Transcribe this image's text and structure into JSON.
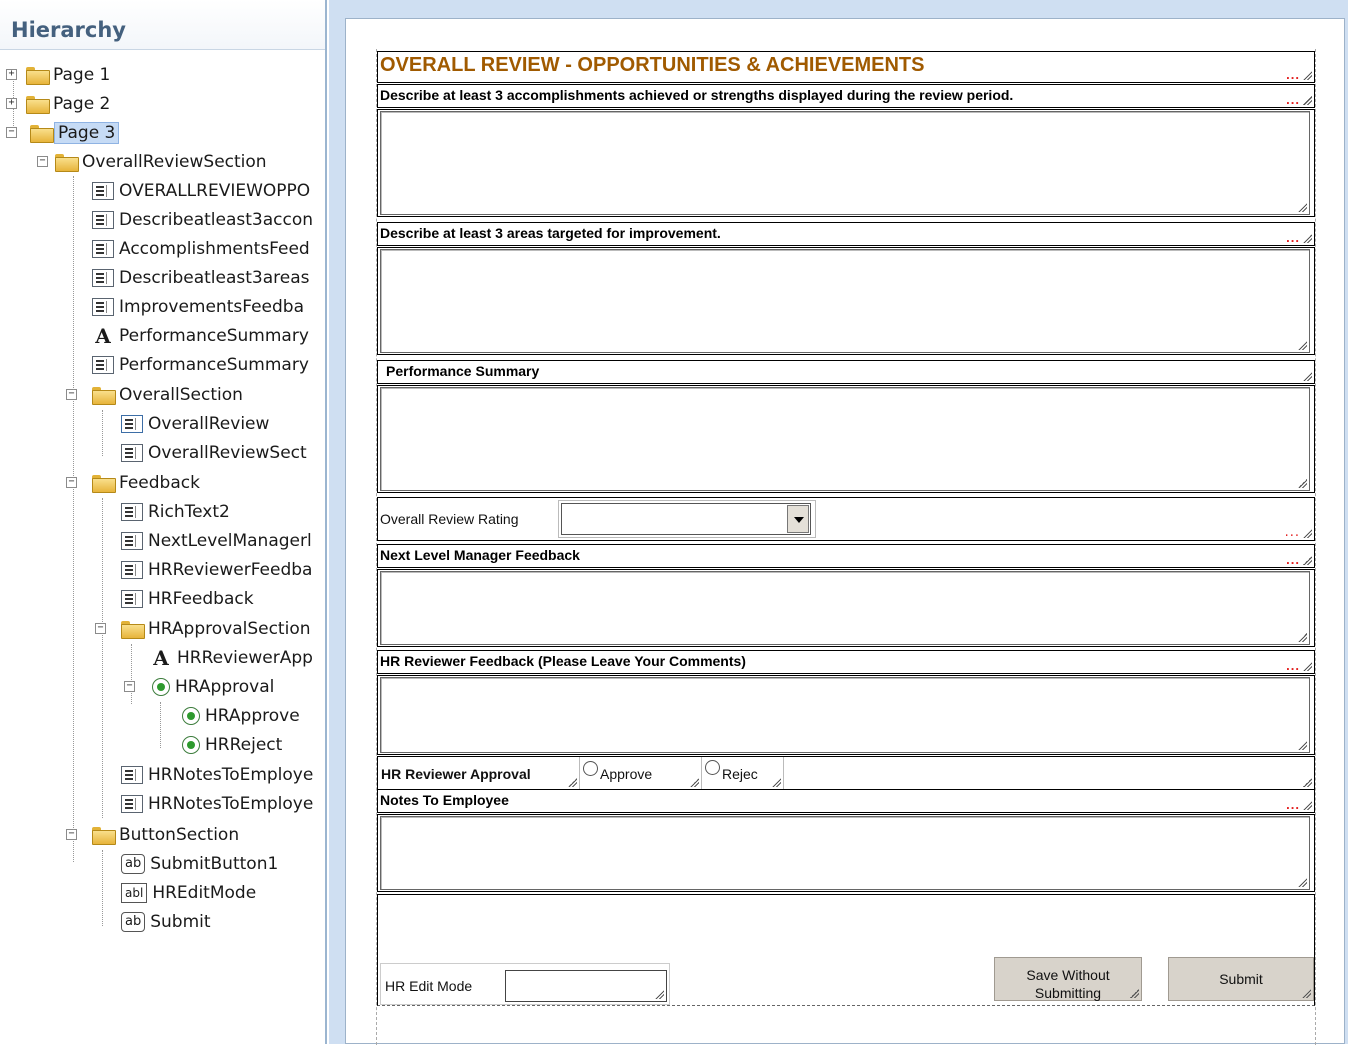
{
  "hierarchy": {
    "title": "Hierarchy",
    "nodes": [
      {
        "label": "Page 1",
        "icon": "folder"
      },
      {
        "label": "Page 2",
        "icon": "folder"
      },
      {
        "label": "Page 3",
        "icon": "folder"
      },
      {
        "label": "OverallReviewSection",
        "icon": "folder"
      },
      {
        "label": "OVERALLREVIEWOPPO",
        "icon": "field"
      },
      {
        "label": "Describeatleast3accon",
        "icon": "field"
      },
      {
        "label": "AccomplishmentsFeed",
        "icon": "field"
      },
      {
        "label": "Describeatleast3areas",
        "icon": "field"
      },
      {
        "label": "ImprovementsFeedba",
        "icon": "field"
      },
      {
        "label": "PerformanceSummary",
        "icon": "text"
      },
      {
        "label": "PerformanceSummary",
        "icon": "field"
      },
      {
        "label": "OverallSection",
        "icon": "folder"
      },
      {
        "label": "OverallReview",
        "icon": "field"
      },
      {
        "label": "OverallReviewSect",
        "icon": "field"
      },
      {
        "label": "Feedback",
        "icon": "folder"
      },
      {
        "label": "RichText2",
        "icon": "field"
      },
      {
        "label": "NextLevelManagerl",
        "icon": "field"
      },
      {
        "label": "HRReviewerFeedba",
        "icon": "field"
      },
      {
        "label": "HRFeedback",
        "icon": "field"
      },
      {
        "label": "HRApprovalSection",
        "icon": "folder"
      },
      {
        "label": "HRReviewerApp",
        "icon": "text"
      },
      {
        "label": "HRApproval",
        "icon": "radio"
      },
      {
        "label": "HRApprove",
        "icon": "radio"
      },
      {
        "label": "HRReject",
        "icon": "radio"
      },
      {
        "label": "HRNotesToEmploye",
        "icon": "field"
      },
      {
        "label": "HRNotesToEmploye",
        "icon": "field"
      },
      {
        "label": "ButtonSection",
        "icon": "folder"
      },
      {
        "label": "SubmitButton1",
        "icon": "ab"
      },
      {
        "label": "HREditMode",
        "icon": "abl"
      },
      {
        "label": "Submit",
        "icon": "ab"
      }
    ]
  },
  "icons": {
    "ab": "ab",
    "abl": "abl",
    "text": "A"
  },
  "form": {
    "title": "OVERALL REVIEW - OPPORTUNITIES & ACHIEVEMENTS",
    "accomplishments_label": "Describe at least 3 accomplishments achieved or strengths displayed during the review period.",
    "improvement_label": "Describe at least 3 areas targeted for improvement.",
    "performance_summary_label": "Performance Summary",
    "overall_rating_label": "Overall Review Rating",
    "next_level_label": "Next Level Manager Feedback",
    "hr_reviewer_feedback_label": "HR Reviewer Feedback (Please Leave Your Comments)",
    "hr_reviewer_approval_label": "HR Reviewer Approval",
    "approve_label": "Approve",
    "reject_label": "Rejec",
    "notes_label": "Notes To Employee",
    "hr_edit_mode_label": "HR Edit Mode",
    "save_without_line1": "Save Without",
    "save_without_line2": "Submitting",
    "submit_label": "Submit",
    "dots": "...",
    "colors": {
      "title": "#a05a00",
      "dots": "#e31e1e",
      "button_bg": "#d8d3cb",
      "panel_bg": "#cfdff2"
    }
  }
}
